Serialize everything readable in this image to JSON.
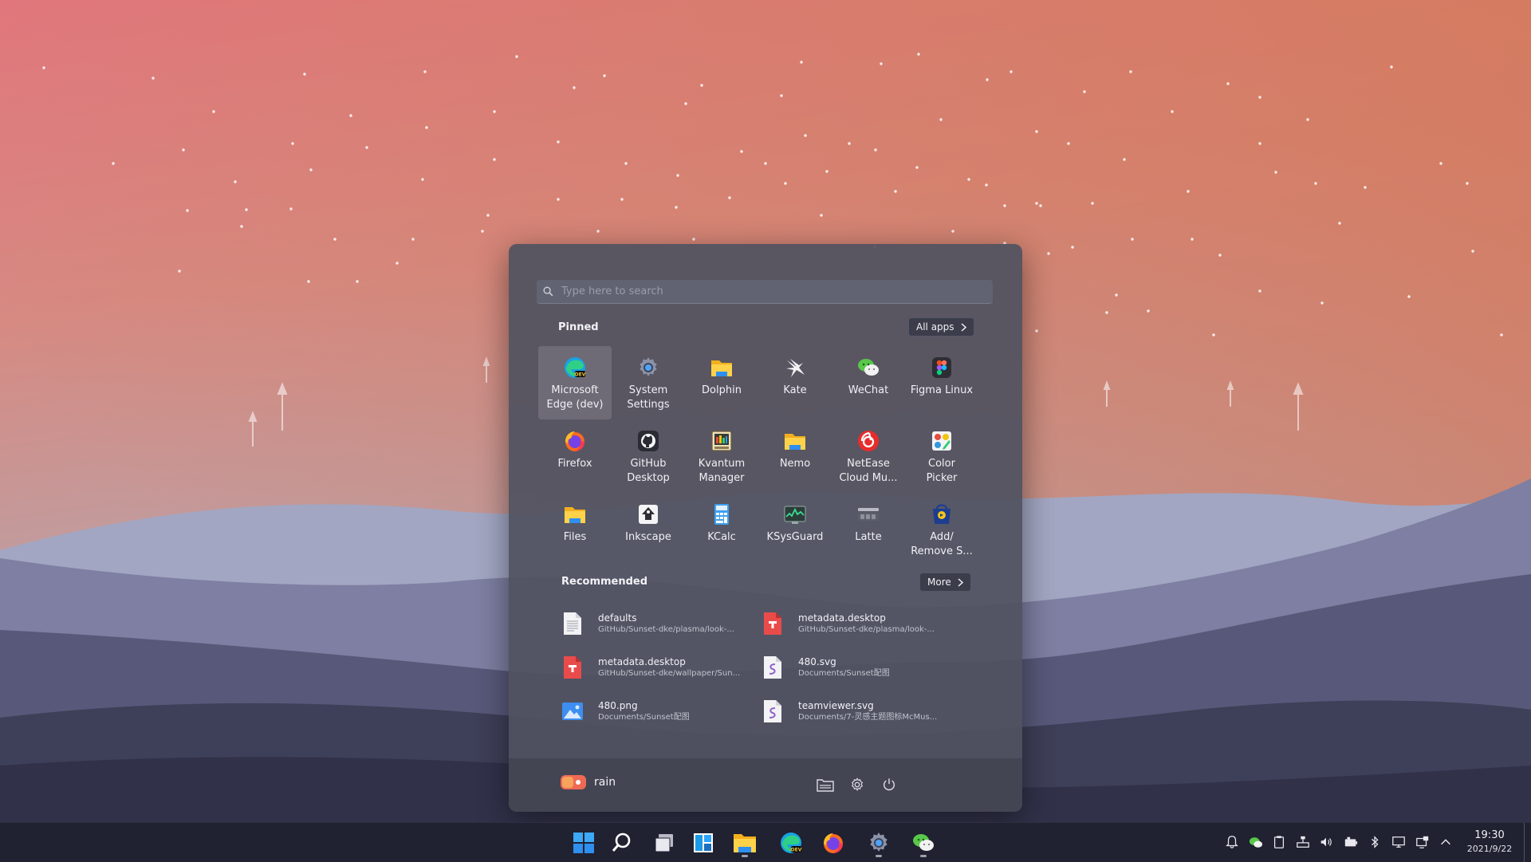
{
  "search": {
    "placeholder": "Type here to search"
  },
  "pinned": {
    "title": "Pinned",
    "all_apps_label": "All apps",
    "apps": [
      {
        "label": "Microsoft\nEdge (dev)",
        "icon": "edge-dev-icon",
        "selected": true
      },
      {
        "label": "System\nSettings",
        "icon": "settings-gear-icon"
      },
      {
        "label": "Dolphin",
        "icon": "folder-icon"
      },
      {
        "label": "Kate",
        "icon": "kate-bird-icon"
      },
      {
        "label": "WeChat",
        "icon": "wechat-icon"
      },
      {
        "label": "Figma Linux",
        "icon": "figma-icon"
      },
      {
        "label": "Firefox",
        "icon": "firefox-icon"
      },
      {
        "label": "GitHub\nDesktop",
        "icon": "github-icon"
      },
      {
        "label": "Kvantum\nManager",
        "icon": "kvantum-icon"
      },
      {
        "label": "Nemo",
        "icon": "folder-icon"
      },
      {
        "label": "NetEase\nCloud Mu...",
        "icon": "netease-music-icon"
      },
      {
        "label": "Color\nPicker",
        "icon": "color-picker-icon"
      },
      {
        "label": "Files",
        "icon": "folder-icon"
      },
      {
        "label": "Inkscape",
        "icon": "inkscape-icon"
      },
      {
        "label": "KCalc",
        "icon": "calculator-icon"
      },
      {
        "label": "KSysGuard",
        "icon": "system-monitor-icon"
      },
      {
        "label": "Latte",
        "icon": "latte-dock-icon"
      },
      {
        "label": "Add/\nRemove S...",
        "icon": "add-remove-software-icon"
      }
    ]
  },
  "recommended": {
    "title": "Recommended",
    "more_label": "More",
    "items": [
      {
        "name": "defaults",
        "path": "GitHub/Sunset-dke/plasma/look-...",
        "icon": "text-file-icon"
      },
      {
        "name": "metadata.desktop",
        "path": "GitHub/Sunset-dke/plasma/look-...",
        "icon": "desktop-file-icon"
      },
      {
        "name": "metadata.desktop",
        "path": "GitHub/Sunset-dke/wallpaper/Sun...",
        "icon": "desktop-file-icon"
      },
      {
        "name": "480.svg",
        "path": "Documents/Sunset配图",
        "icon": "svg-file-icon"
      },
      {
        "name": "480.png",
        "path": "Documents/Sunset配图",
        "icon": "image-file-icon"
      },
      {
        "name": "teamviewer.svg",
        "path": "Documents/7-灵感主题图标McMus...",
        "icon": "svg-file-icon"
      }
    ]
  },
  "user": {
    "name": "rain",
    "avatar": "user-avatar-icon"
  },
  "footer_buttons": [
    "documents-folder-icon",
    "settings-gear-icon",
    "power-icon"
  ],
  "taskbar": {
    "apps": [
      {
        "icon": "start-windows-icon",
        "active": false
      },
      {
        "icon": "search-icon",
        "active": false
      },
      {
        "icon": "task-view-icon",
        "active": false
      },
      {
        "icon": "widgets-icon",
        "active": false
      },
      {
        "icon": "file-explorer-icon",
        "active": true
      },
      {
        "icon": "edge-dev-icon",
        "active": false
      },
      {
        "icon": "firefox-icon",
        "active": false
      },
      {
        "icon": "settings-gear-icon",
        "active": true
      },
      {
        "icon": "wechat-icon",
        "active": true
      }
    ],
    "tray": [
      "notifications-bell-icon",
      "wechat-tray-icon",
      "clipboard-icon",
      "network-wired-icon",
      "volume-icon",
      "battery-icon",
      "bluetooth-icon",
      "display-icon",
      "screen-share-icon",
      "chevron-up-icon"
    ],
    "clock": {
      "time": "19:30",
      "date": "2021/9/22"
    }
  },
  "colors": {
    "sky_top": "#e0757f",
    "sky_mid": "#c79c9a",
    "menu_bg": "#505260",
    "taskbar_bg": "#202131",
    "accent_blue": "#2f8ff0"
  }
}
